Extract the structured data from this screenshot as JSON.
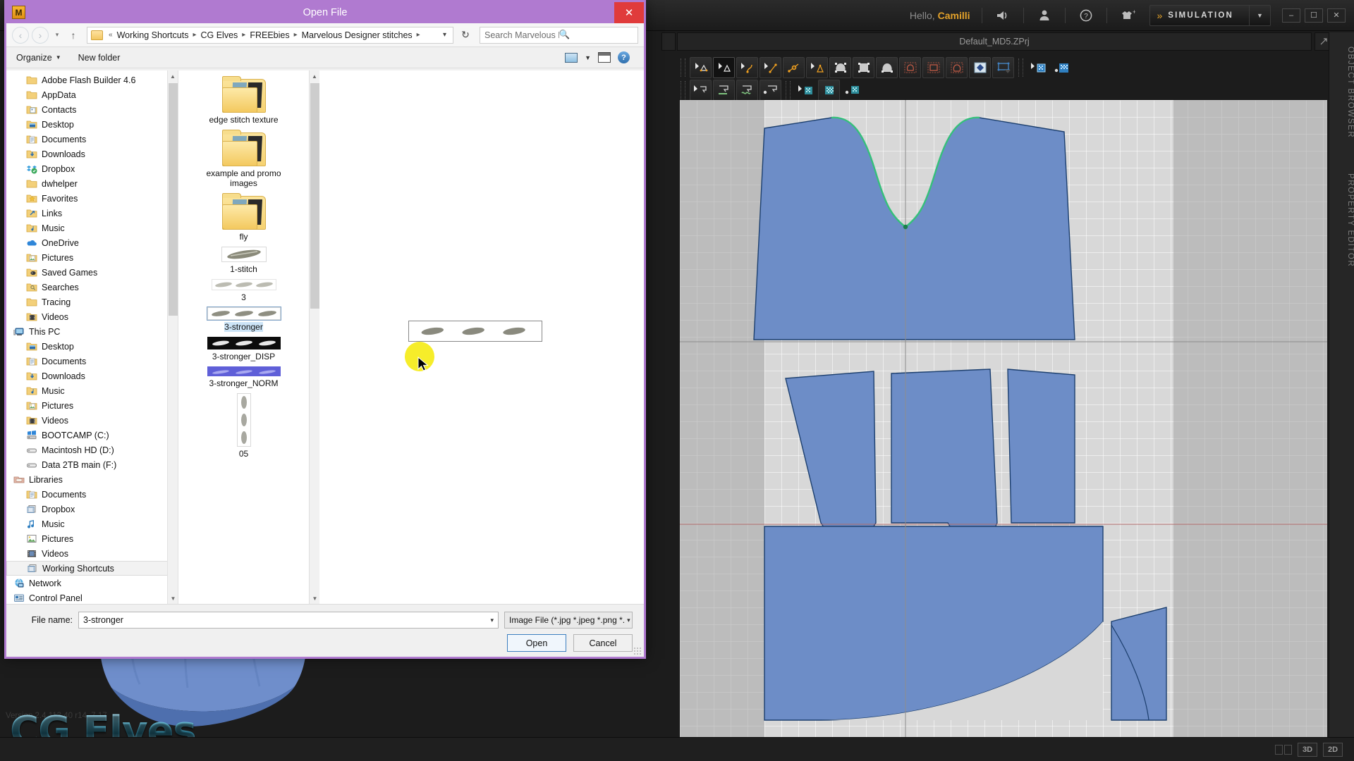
{
  "app": {
    "name": "Marvelous Designer",
    "greeting_prefix": "Hello,",
    "user": "Camilli",
    "mode_label": "SIMULATION",
    "file_tab": "Default_MD5.ZPrj",
    "version_text": "Version 2.4.113.40 r14, 7.17",
    "watermark": "CG Elves",
    "right_rail": [
      "OBJECT BROWSER",
      "PROPERTY EDITOR"
    ],
    "window_buttons": [
      "minimize",
      "maximize",
      "close"
    ],
    "status_buttons": [
      "split-view",
      "3D",
      "2D"
    ],
    "topbar_icons": [
      "speaker-icon",
      "user-icon",
      "help-icon",
      "garment-add-icon"
    ],
    "colors": {
      "accent": "#e5a32a",
      "dialog_border": "#b07ad0",
      "titlebar": "#b07ad0",
      "close_button": "#e03b3b",
      "pattern_fill": "#6d8dc7",
      "selection": "#cce4f7"
    }
  },
  "dialog": {
    "title": "Open File",
    "app_icon": "M",
    "close_label": "✕",
    "nav": {
      "back": "‹",
      "forward": "›",
      "recent": "▾",
      "up": "↑",
      "refresh": "↻",
      "crumb_prefix": "«",
      "breadcrumbs": [
        "Working Shortcuts",
        "CG Elves",
        "FREEbies",
        "Marvelous Designer stitches"
      ],
      "dropdown": "⌵"
    },
    "search": {
      "placeholder": "Search Marvelous Designer sti...",
      "icon": "search-icon"
    },
    "commandbar": {
      "organize": "Organize",
      "new_folder": "New folder",
      "view_icon": "view-icon",
      "pane_icon": "preview-pane-icon",
      "help_icon": "help-icon"
    },
    "tree": [
      {
        "label": "Adobe Flash Builder 4.6",
        "icon": "folder-icon",
        "indent": 1
      },
      {
        "label": "AppData",
        "icon": "folder-icon",
        "indent": 1
      },
      {
        "label": "Contacts",
        "icon": "contacts-folder-icon",
        "indent": 1
      },
      {
        "label": "Desktop",
        "icon": "desktop-folder-icon",
        "indent": 1
      },
      {
        "label": "Documents",
        "icon": "documents-folder-icon",
        "indent": 1
      },
      {
        "label": "Downloads",
        "icon": "downloads-folder-icon",
        "indent": 1
      },
      {
        "label": "Dropbox",
        "icon": "dropbox-icon",
        "indent": 1
      },
      {
        "label": "dwhelper",
        "icon": "folder-icon",
        "indent": 1
      },
      {
        "label": "Favorites",
        "icon": "favorites-folder-icon",
        "indent": 1
      },
      {
        "label": "Links",
        "icon": "links-folder-icon",
        "indent": 1
      },
      {
        "label": "Music",
        "icon": "music-folder-icon",
        "indent": 1
      },
      {
        "label": "OneDrive",
        "icon": "onedrive-icon",
        "indent": 1
      },
      {
        "label": "Pictures",
        "icon": "pictures-folder-icon",
        "indent": 1
      },
      {
        "label": "Saved Games",
        "icon": "saved-games-folder-icon",
        "indent": 1
      },
      {
        "label": "Searches",
        "icon": "searches-folder-icon",
        "indent": 1
      },
      {
        "label": "Tracing",
        "icon": "folder-icon",
        "indent": 1
      },
      {
        "label": "Videos",
        "icon": "videos-folder-icon",
        "indent": 1
      },
      {
        "label": "This PC",
        "icon": "this-pc-icon",
        "indent": 0
      },
      {
        "label": "Desktop",
        "icon": "desktop-folder-icon",
        "indent": 1
      },
      {
        "label": "Documents",
        "icon": "documents-folder-icon",
        "indent": 1
      },
      {
        "label": "Downloads",
        "icon": "downloads-folder-icon",
        "indent": 1
      },
      {
        "label": "Music",
        "icon": "music-folder-icon",
        "indent": 1
      },
      {
        "label": "Pictures",
        "icon": "pictures-folder-icon",
        "indent": 1
      },
      {
        "label": "Videos",
        "icon": "videos-folder-icon",
        "indent": 1
      },
      {
        "label": "BOOTCAMP (C:)",
        "icon": "windows-drive-icon",
        "indent": 1
      },
      {
        "label": "Macintosh HD (D:)",
        "icon": "drive-icon",
        "indent": 1
      },
      {
        "label": "Data 2TB main (F:)",
        "icon": "drive-icon",
        "indent": 1
      },
      {
        "label": "Libraries",
        "icon": "libraries-icon",
        "indent": 0
      },
      {
        "label": "Documents",
        "icon": "documents-folder-icon",
        "indent": 1
      },
      {
        "label": "Dropbox",
        "icon": "dropbox-library-icon",
        "indent": 1
      },
      {
        "label": "Music",
        "icon": "music-note-icon",
        "indent": 1
      },
      {
        "label": "Pictures",
        "icon": "pictures-library-icon",
        "indent": 1
      },
      {
        "label": "Videos",
        "icon": "videos-library-icon",
        "indent": 1
      },
      {
        "label": "Working Shortcuts",
        "icon": "shortcut-library-icon",
        "indent": 1,
        "selected": true
      },
      {
        "label": "Network",
        "icon": "network-icon",
        "indent": 0
      },
      {
        "label": "Control Panel",
        "icon": "control-panel-icon",
        "indent": 0
      }
    ],
    "files": [
      {
        "label": "edge stitch texture",
        "type": "folder"
      },
      {
        "label": "example and promo images",
        "type": "folder"
      },
      {
        "label": "fly",
        "type": "folder"
      },
      {
        "label": "1-stitch",
        "type": "image-single"
      },
      {
        "label": "3",
        "type": "image-triple-light"
      },
      {
        "label": "3-stronger",
        "type": "image-triple",
        "selected": true
      },
      {
        "label": "3-stronger_DISP",
        "type": "image-disp"
      },
      {
        "label": "3-stronger_NORM",
        "type": "image-norm"
      },
      {
        "label": "05",
        "type": "image-vertical"
      }
    ],
    "footer": {
      "filename_label": "File name:",
      "filename_value": "3-stronger",
      "filetype_value": "Image File (*.jpg *.jpeg *.png *.",
      "open_label": "Open",
      "cancel_label": "Cancel"
    }
  }
}
